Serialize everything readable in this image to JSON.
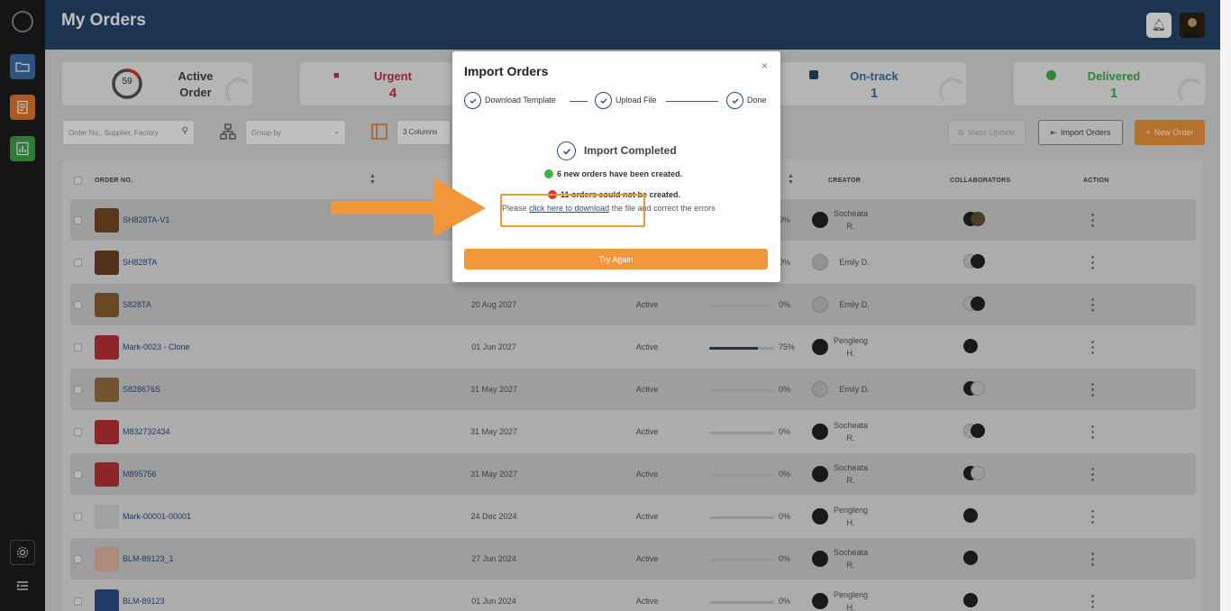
{
  "page_title": "My Orders",
  "summary": {
    "active_label": "Active\nOrder",
    "active_count": "59",
    "urgent_label": "Urgent",
    "urgent_count": "4",
    "ontrack_label": "On-track",
    "ontrack_count": "1",
    "delivered_label": "Delivered",
    "delivered_count": "1"
  },
  "toolbar": {
    "search_placeholder": "Order No., Supplier, Factory",
    "groupby_placeholder": "Group by",
    "columns_label": "3 Columns",
    "mass_update": "Mass Update",
    "import_orders": "Import Orders",
    "new_order": "New Order"
  },
  "table": {
    "headers": {
      "order_no": "ORDER NO.",
      "creator": "CREATOR",
      "collaborators": "COLLABORATORS",
      "action": "ACTION"
    },
    "rows": [
      {
        "order_no": "SH828TA-V1",
        "date": "",
        "status": "",
        "progress": 0,
        "progress_label": "0%",
        "creator": "Socheata R."
      },
      {
        "order_no": "SH828TA",
        "date": "",
        "status": "",
        "progress": 0,
        "progress_label": "0%",
        "creator": "Emily D."
      },
      {
        "order_no": "S828TA",
        "date": "20 Aug 2027",
        "status": "Active",
        "progress": 0,
        "progress_label": "0%",
        "creator": "Emily D."
      },
      {
        "order_no": "Mark-0023 - Clone",
        "date": "01 Jun 2027",
        "status": "Active",
        "progress": 0.75,
        "progress_label": "75%",
        "creator": "Pengleng H."
      },
      {
        "order_no": "S828676S",
        "date": "31 May 2027",
        "status": "Active",
        "progress": 0,
        "progress_label": "0%",
        "creator": "Emily D."
      },
      {
        "order_no": "M832732434",
        "date": "31 May 2027",
        "status": "Active",
        "progress": 0,
        "progress_label": "0%",
        "creator": "Socheata R."
      },
      {
        "order_no": "M895756",
        "date": "31 May 2027",
        "status": "Active",
        "progress": 0,
        "progress_label": "0%",
        "creator": "Socheata R."
      },
      {
        "order_no": "Mark-00001-00001",
        "date": "24 Dec 2024",
        "status": "Active",
        "progress": 0,
        "progress_label": "0%",
        "creator": "Pengleng H."
      },
      {
        "order_no": "BLM-89123_1",
        "date": "27 Jun 2024",
        "status": "Active",
        "progress": 0,
        "progress_label": "0%",
        "creator": "Socheata R."
      },
      {
        "order_no": "BLM-89123",
        "date": "01 Jun 2024",
        "status": "Active",
        "progress": 0,
        "progress_label": "0%",
        "creator": "Pengleng H."
      }
    ]
  },
  "modal": {
    "title": "Import Orders",
    "close": "×",
    "steps": [
      "Download Template",
      "Upload File",
      "Done"
    ],
    "completed_title": "Import Completed",
    "success_text": "6 new orders have been created.",
    "error_text": "11 orders could not be created.",
    "help_prefix": "Please ",
    "help_link": "click here to download",
    "help_suffix": " the file and correct the errors",
    "try_again": "Try Again"
  },
  "colors": {
    "brand": "#27466d",
    "accent": "#f2963a",
    "success": "#3bb34a",
    "error": "#d63b3b",
    "urgent": "#c0334a"
  }
}
